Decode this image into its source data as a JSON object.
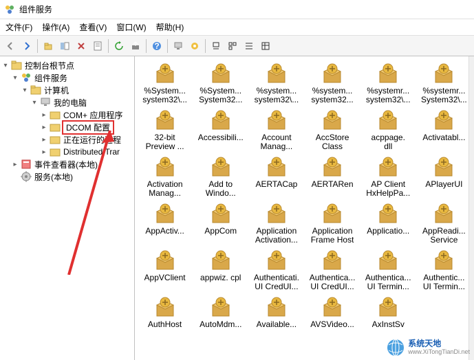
{
  "title": "组件服务",
  "menu": {
    "file": "文件(F)",
    "action": "操作(A)",
    "view": "查看(V)",
    "window": "窗口(W)",
    "help": "帮助(H)"
  },
  "tree": {
    "root": "控制台根节点",
    "l1": "组件服务",
    "l2": "计算机",
    "l3": "我的电脑",
    "children": [
      "COM+ 应用程序",
      "DCOM 配置",
      "正在运行的进程",
      "Distributed Trar"
    ],
    "eventViewer": "事件查看器(本地)",
    "services": "服务(本地)"
  },
  "items": [
    {
      "l1": "%System...",
      "l2": "system32\\..."
    },
    {
      "l1": "%System...",
      "l2": "System32..."
    },
    {
      "l1": "%system...",
      "l2": "system32\\..."
    },
    {
      "l1": "%system...",
      "l2": "system32..."
    },
    {
      "l1": "%systemr...",
      "l2": "system32\\..."
    },
    {
      "l1": "%systemr...",
      "l2": "System32\\..."
    },
    {
      "l1": "32-bit",
      "l2": "Preview ..."
    },
    {
      "l1": "Accessibili...",
      "l2": ""
    },
    {
      "l1": "Account",
      "l2": "Manag..."
    },
    {
      "l1": "AccStore",
      "l2": "Class"
    },
    {
      "l1": "acppage.",
      "l2": "dll"
    },
    {
      "l1": "Activatabl...",
      "l2": ""
    },
    {
      "l1": "Activation",
      "l2": "Manag..."
    },
    {
      "l1": "Add to",
      "l2": "Windo..."
    },
    {
      "l1": "AERTACap",
      "l2": ""
    },
    {
      "l1": "AERTARen",
      "l2": ""
    },
    {
      "l1": "AP Client",
      "l2": "HxHelpPa..."
    },
    {
      "l1": "APlayerUI",
      "l2": ""
    },
    {
      "l1": "AppActiv...",
      "l2": ""
    },
    {
      "l1": "AppCom",
      "l2": ""
    },
    {
      "l1": "Application",
      "l2": "Activation..."
    },
    {
      "l1": "Application",
      "l2": "Frame Host"
    },
    {
      "l1": "Applicatio...",
      "l2": ""
    },
    {
      "l1": "AppReadi...",
      "l2": "Service"
    },
    {
      "l1": "AppVClient",
      "l2": ""
    },
    {
      "l1": "appwiz. cpl",
      "l2": ""
    },
    {
      "l1": "Authenticati.",
      "l2": "UI CredUI..."
    },
    {
      "l1": "Authentica...",
      "l2": "UI CredUI..."
    },
    {
      "l1": "Authentica...",
      "l2": "UI Termin..."
    },
    {
      "l1": "Authentic...",
      "l2": "UI Termin..."
    },
    {
      "l1": "AuthHost",
      "l2": ""
    },
    {
      "l1": "AutoMdm...",
      "l2": ""
    },
    {
      "l1": "Available...",
      "l2": ""
    },
    {
      "l1": "AVSVideo...",
      "l2": ""
    },
    {
      "l1": "AxInstSv",
      "l2": ""
    }
  ],
  "watermark": {
    "cn": "系统天地",
    "url": "www.XiTongTianDi.net"
  }
}
